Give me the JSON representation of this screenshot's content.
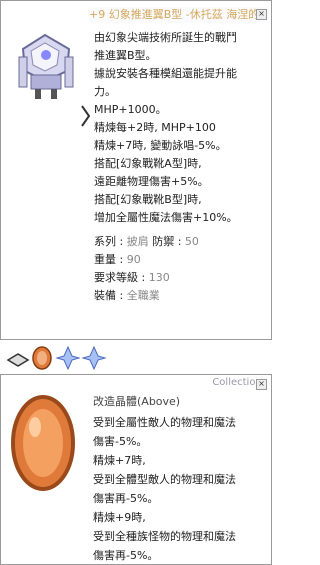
{
  "item": {
    "title": "+9 幻象推進翼B型 -休托茲 海涅的",
    "description": [
      "由幻象尖端技術所誕生的戰鬥",
      "推進翼B型。",
      "據說安裝各種模組還能提升能",
      "力。"
    ],
    "effects": [
      "MHP+1000。",
      "精煉每+2時, MHP+100",
      "精煉+7時, 變動詠唱-5%。",
      "搭配[幻象戰靴A型]時,",
      "遠距離物理傷害+5%。",
      "搭配[幻象戰靴B型]時,",
      "增加全屬性魔法傷害+10%。"
    ],
    "stats": [
      {
        "label": "系列 : ",
        "value": "披肩",
        "label2": " 防禦 : ",
        "value2": "50"
      },
      {
        "label": "重量 : ",
        "value": "90"
      },
      {
        "label": "要求等級 : ",
        "value": "130"
      },
      {
        "label": "裝備 : ",
        "value": "全職業"
      }
    ]
  },
  "card": {
    "watermark": "Collections",
    "name": "改造晶體(Above)",
    "lines": [
      "受到全屬性敵人的物理和魔法",
      "傷害-5%。",
      "精煉+7時,",
      "受到全體型敵人的物理和魔法",
      "傷害再-5%。",
      "精煉+9時,",
      "受到全種族怪物的物理和魔法",
      "傷害再-5%。"
    ]
  },
  "icons": {
    "item": "wing-mech-icon",
    "card": "orange-gem-icon",
    "slots": [
      "gem-slot-icon",
      "orange-gem-slot-icon",
      "blue-crystal-slot-icon",
      "blue-crystal-slot-icon"
    ]
  },
  "colors": {
    "title": "#d4a85a",
    "gem_orange": "#e07a3a",
    "crystal_blue": "#7aa0e8"
  }
}
